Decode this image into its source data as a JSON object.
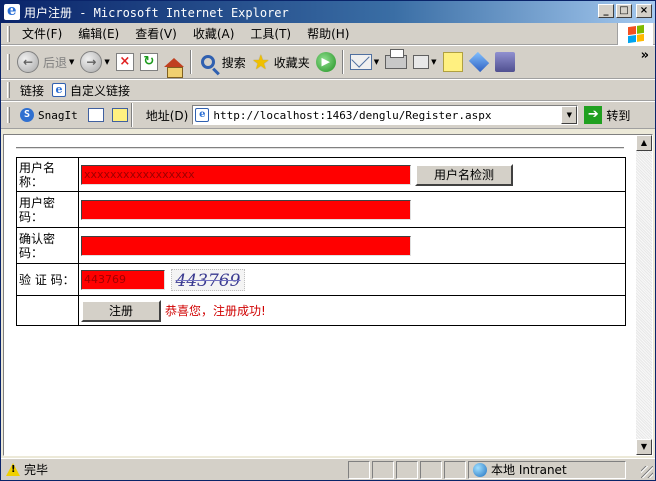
{
  "window": {
    "title": "用户注册 - Microsoft Internet Explorer",
    "controls": {
      "minimize": "_",
      "maximize": "□",
      "close": "×"
    }
  },
  "menubar": {
    "items": [
      "文件(F)",
      "编辑(E)",
      "查看(V)",
      "收藏(A)",
      "工具(T)",
      "帮助(H)"
    ]
  },
  "toolbar": {
    "back_label": "后退",
    "search_label": "搜索",
    "favorites_label": "收藏夹",
    "chevron": "»"
  },
  "linksbar": {
    "links_label": "链接",
    "custom_links_label": "自定义链接"
  },
  "snagit": {
    "label": "SnagIt"
  },
  "address": {
    "label": "地址(D)",
    "url": "http://localhost:1463/denglu/Register.aspx",
    "go_label": "转到"
  },
  "form": {
    "username_label": "用户名称：",
    "username_value": "xxxxxxxxxxxxxxxxx",
    "check_username_button": "用户名检测",
    "password_label": "用户密码：",
    "password_value": "",
    "confirm_label": "确认密码：",
    "confirm_value": "",
    "captcha_label": "验 证 码：",
    "captcha_value": "443769",
    "captcha_image_text": "443769",
    "register_button": "注册",
    "success_message": "恭喜您，注册成功!",
    "input_color": "#ff0000",
    "message_color": "#d00000"
  },
  "statusbar": {
    "status_text": "完毕",
    "zone_text": "本地 Intranet"
  }
}
